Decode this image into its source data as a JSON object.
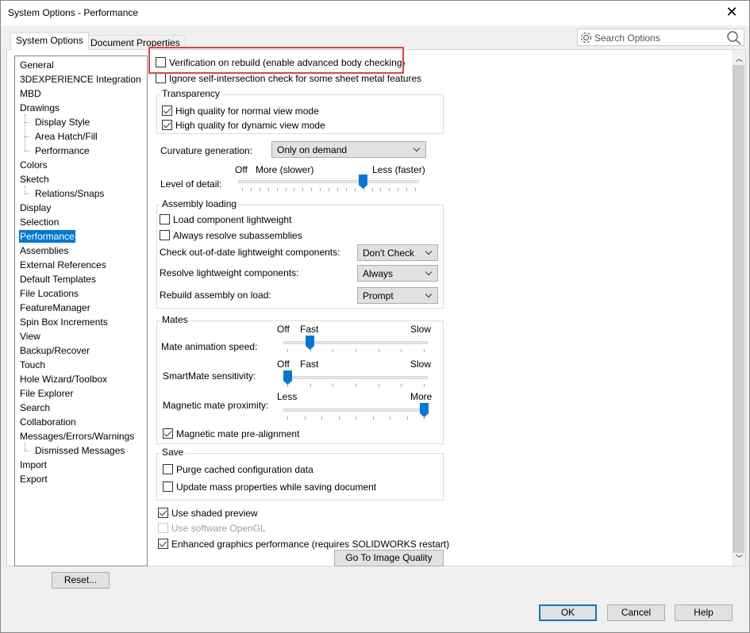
{
  "window": {
    "title": "System Options - Performance",
    "close_icon": "close-icon"
  },
  "tabs": [
    "System Options",
    "Document Properties"
  ],
  "search": {
    "placeholder": "Search Options",
    "icons": [
      "gear-icon",
      "search-icon"
    ]
  },
  "tree": [
    {
      "label": "General",
      "level": 0
    },
    {
      "label": "3DEXPERIENCE Integration",
      "level": 0
    },
    {
      "label": "MBD",
      "level": 0
    },
    {
      "label": "Drawings",
      "level": 0
    },
    {
      "label": "Display Style",
      "level": 1
    },
    {
      "label": "Area Hatch/Fill",
      "level": 1
    },
    {
      "label": "Performance",
      "level": 1
    },
    {
      "label": "Colors",
      "level": 0
    },
    {
      "label": "Sketch",
      "level": 0
    },
    {
      "label": "Relations/Snaps",
      "level": 1
    },
    {
      "label": "Display",
      "level": 0
    },
    {
      "label": "Selection",
      "level": 0
    },
    {
      "label": "Performance",
      "level": 0,
      "selected": true
    },
    {
      "label": "Assemblies",
      "level": 0
    },
    {
      "label": "External References",
      "level": 0
    },
    {
      "label": "Default Templates",
      "level": 0
    },
    {
      "label": "File Locations",
      "level": 0
    },
    {
      "label": "FeatureManager",
      "level": 0
    },
    {
      "label": "Spin Box Increments",
      "level": 0
    },
    {
      "label": "View",
      "level": 0
    },
    {
      "label": "Backup/Recover",
      "level": 0
    },
    {
      "label": "Touch",
      "level": 0
    },
    {
      "label": "Hole Wizard/Toolbox",
      "level": 0
    },
    {
      "label": "File Explorer",
      "level": 0
    },
    {
      "label": "Search",
      "level": 0
    },
    {
      "label": "Collaboration",
      "level": 0
    },
    {
      "label": "Messages/Errors/Warnings",
      "level": 0
    },
    {
      "label": "Dismissed Messages",
      "level": 1
    },
    {
      "label": "Import",
      "level": 0
    },
    {
      "label": "Export",
      "level": 0
    }
  ],
  "reset_label": "Reset...",
  "options": {
    "verification": {
      "label": "Verification on rebuild (enable advanced body checking)",
      "checked": false
    },
    "ignore_self": {
      "label": "Ignore self-intersection check for some sheet metal features",
      "checked": false
    },
    "transparency": {
      "title": "Transparency",
      "normal": {
        "label": "High quality for normal view mode",
        "checked": true
      },
      "dynamic": {
        "label": "High quality for dynamic view mode",
        "checked": true
      }
    },
    "curvature": {
      "label": "Curvature generation:",
      "value": "Only on demand"
    },
    "detail": {
      "label": "Level of detail:",
      "off": "Off",
      "more": "More (slower)",
      "less": "Less (faster)",
      "value": 14,
      "max": 20
    },
    "assembly": {
      "title": "Assembly loading",
      "lightweight": {
        "label": "Load component lightweight",
        "checked": false
      },
      "resolve_sub": {
        "label": "Always resolve subassemblies",
        "checked": false
      },
      "check": {
        "label": "Check out-of-date lightweight components:",
        "value": "Don't Check"
      },
      "resolve": {
        "label": "Resolve lightweight components:",
        "value": "Always"
      },
      "rebuild": {
        "label": "Rebuild assembly on load:",
        "value": "Prompt"
      }
    },
    "mates": {
      "title": "Mates",
      "anim": {
        "label": "Mate animation speed:",
        "off": "Off",
        "fast": "Fast",
        "slow": "Slow",
        "value": 1,
        "max": 6
      },
      "smart": {
        "label": "SmartMate sensitivity:",
        "off": "Off",
        "fast": "Fast",
        "slow": "Slow",
        "value": 0,
        "max": 6
      },
      "prox": {
        "label": "Magnetic mate proximity:",
        "less": "Less",
        "more": "More",
        "value": 8,
        "max": 8
      },
      "prealign": {
        "label": "Magnetic mate pre-alignment",
        "checked": true
      }
    },
    "save": {
      "title": "Save",
      "purge": {
        "label": "Purge cached configuration data",
        "checked": false
      },
      "mass": {
        "label": "Update mass properties while saving document",
        "checked": false
      }
    },
    "shaded": {
      "label": "Use shaded preview",
      "checked": true
    },
    "opengl": {
      "label": "Use software OpenGL",
      "checked": false,
      "disabled": true
    },
    "enhanced": {
      "label": "Enhanced graphics performance (requires SOLIDWORKS restart)",
      "checked": true
    },
    "image_quality_label": "Go To Image Quality"
  },
  "buttons": {
    "ok": "OK",
    "cancel": "Cancel",
    "help": "Help"
  },
  "accent": "#0078d7",
  "highlight_box": "#e84040"
}
